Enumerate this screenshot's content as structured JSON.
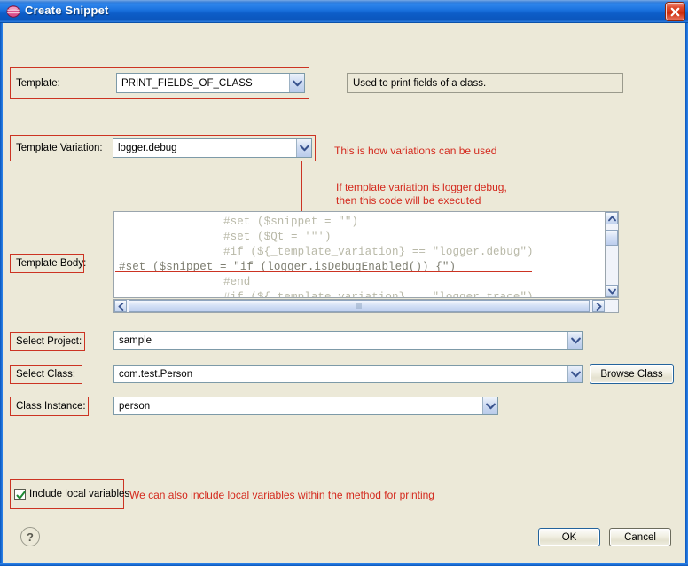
{
  "window": {
    "title": "Create Snippet",
    "close_label": "×",
    "app_icon": "snippet-globe-icon"
  },
  "fields": {
    "template": {
      "label": "Template:",
      "value": "PRINT_FIELDS_OF_CLASS",
      "description": "Used to print fields of a class."
    },
    "template_variation": {
      "label": "Template Variation:",
      "value": "logger.debug"
    },
    "template_body": {
      "label": "Template Body:"
    },
    "select_project": {
      "label": "Select Project:",
      "value": "sample"
    },
    "select_class": {
      "label": "Select Class:",
      "value": "com.test.Person",
      "browse_label": "Browse Class"
    },
    "class_instance": {
      "label": "Class Instance:",
      "value": "person"
    }
  },
  "code": {
    "lines": [
      "#set ($snippet = \"\")",
      "#set ($Qt = '\"')",
      "#if (${_template_variation} == \"logger.debug\")",
      "#set ($snippet = \"if (logger.isDebugEnabled()) {\")",
      "#end",
      "#if (${_template_variation} == \"logger.trace\")"
    ]
  },
  "annotations": {
    "variations": "This is how variations can be used",
    "debug_line1": "If template variation is logger.debug,",
    "debug_line2": "then this code will be executed",
    "local_vars": "We can also include local variables within the method for printing"
  },
  "checkbox": {
    "label": "Include local variables",
    "checked": true
  },
  "buttons": {
    "ok": "OK",
    "cancel": "Cancel",
    "help": "?"
  },
  "colors": {
    "annotation_red": "#d42a1e",
    "highlight_box": "#cc3322",
    "titlebar_blue": "#1a72de",
    "dialog_bg": "#ece9d8"
  }
}
